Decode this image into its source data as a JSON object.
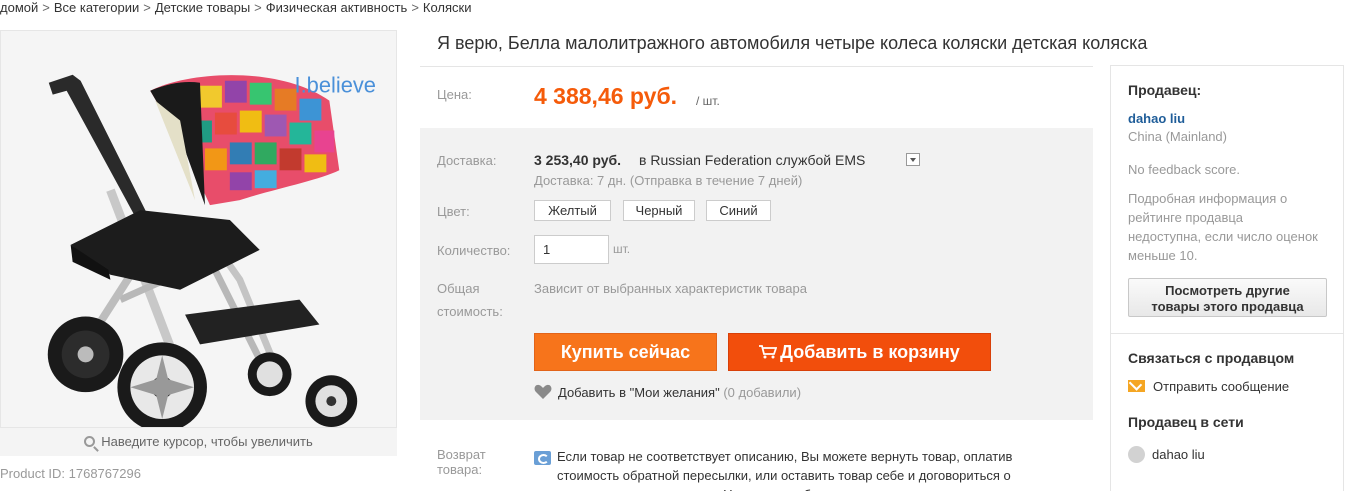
{
  "breadcrumb": {
    "items": [
      "домой",
      "Все категории",
      "Детские товары",
      "Физическая активность",
      "Коляски"
    ],
    "separator": ">"
  },
  "gallery": {
    "brand_logo": "I.believe",
    "zoom_hint": "Наведите курсор, чтобы увеличить",
    "product_id": "Product ID: 1768767296"
  },
  "product": {
    "title": "Я верю, Белла малолитражного автомобиля четыре колеса коляски детская коляска"
  },
  "price": {
    "label": "Цена:",
    "value": "4 388,46 руб.",
    "unit": "/ шт."
  },
  "shipping": {
    "label": "Доставка:",
    "price": "3 253,40 руб.",
    "destination": "в Russian Federation службой EMS",
    "time": "Доставка: 7 дн. (Отправка в течение 7 дней)"
  },
  "color": {
    "label": "Цвет:",
    "options": [
      "Желтый",
      "Черный",
      "Синий"
    ]
  },
  "quantity": {
    "label": "Количество:",
    "value": "1",
    "unit": "шт."
  },
  "total": {
    "label_line1": "Общая",
    "label_line2": "стоимость:",
    "text": "Зависит от выбранных характеристик товара"
  },
  "actions": {
    "buy_now": "Купить сейчас",
    "add_to_cart": "Добавить в корзину",
    "wishlist": "Добавить в \"Мои желания\"",
    "wishlist_count": "(0 добавили)"
  },
  "returns": {
    "label_line1": "Возврат",
    "label_line2": "товара:",
    "text": "Если товар не соответствует описанию, Вы можете вернуть товар, оплатив стоимость обратной пересылки, или оставить товар себе и договориться о компенсации с продавцом. Узнать подробнее »"
  },
  "seller": {
    "header": "Продавец:",
    "name": "dahao liu",
    "country": "China (Mainland)",
    "feedback": "No feedback score.",
    "info": "Подробная информация о рейтинге продавца недоступна, если число оценок меньше 10.",
    "other_items_line1": "Посмотреть другие",
    "other_items_line2": "товары этого продавца",
    "contact_header": "Связаться с продавцом",
    "send_message": "Отправить сообщение",
    "online_header": "Продавец в сети",
    "online_name": "dahao liu"
  },
  "colors": {
    "accent_orange": "#f7741b",
    "cart_red_orange": "#f24e0c",
    "price_orange": "#f55b0a",
    "link_blue": "#1f5d99"
  }
}
